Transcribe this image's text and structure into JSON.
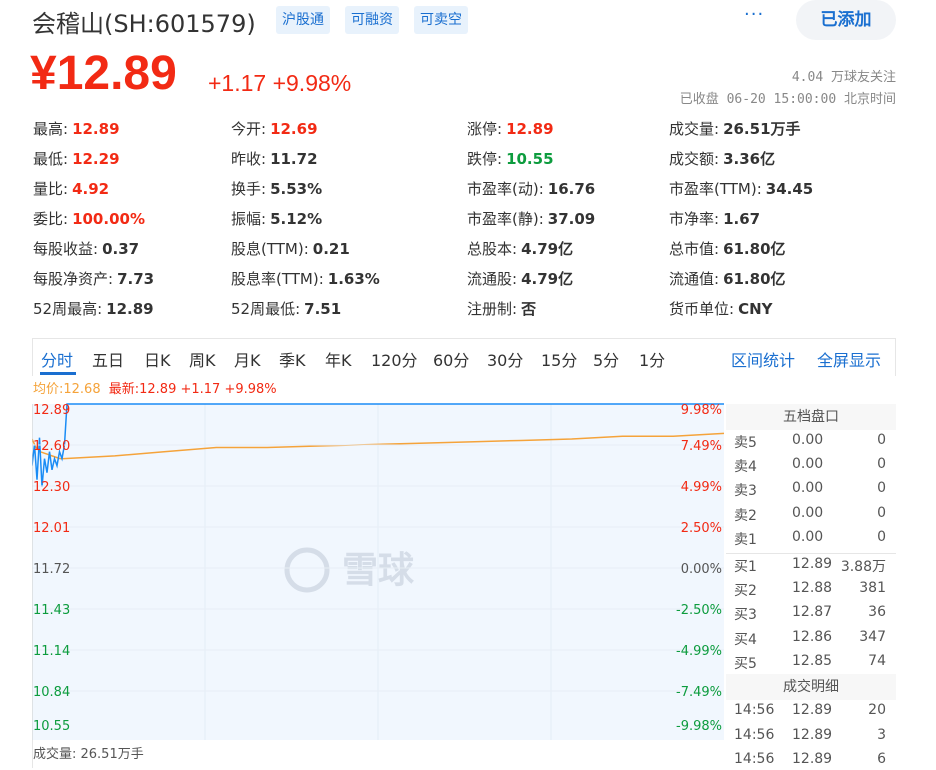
{
  "header": {
    "title": "会稽山(SH:601579)",
    "tags": [
      "沪股通",
      "可融资",
      "可卖空"
    ],
    "more": "···",
    "added_label": "已添加"
  },
  "quote": {
    "price": "¥12.89",
    "change": "+1.17 +9.98%",
    "followers": "4.04 万球友关注",
    "status": "已收盘 06-20 15:00:00 北京时间"
  },
  "stats": [
    [
      {
        "k": "最高:",
        "v": "12.89",
        "c": "red"
      },
      {
        "k": "今开:",
        "v": "12.69",
        "c": "red"
      },
      {
        "k": "涨停:",
        "v": "12.89",
        "c": "red"
      },
      {
        "k": "成交量:",
        "v": "26.51万手",
        "c": ""
      }
    ],
    [
      {
        "k": "最低:",
        "v": "12.29",
        "c": "red"
      },
      {
        "k": "昨收:",
        "v": "11.72",
        "c": ""
      },
      {
        "k": "跌停:",
        "v": "10.55",
        "c": "green"
      },
      {
        "k": "成交额:",
        "v": "3.36亿",
        "c": ""
      }
    ],
    [
      {
        "k": "量比:",
        "v": "4.92",
        "c": "red"
      },
      {
        "k": "换手:",
        "v": "5.53%",
        "c": ""
      },
      {
        "k": "市盈率(动):",
        "v": "16.76",
        "c": ""
      },
      {
        "k": "市盈率(TTM):",
        "v": "34.45",
        "c": ""
      }
    ],
    [
      {
        "k": "委比:",
        "v": "100.00%",
        "c": "red"
      },
      {
        "k": "振幅:",
        "v": "5.12%",
        "c": ""
      },
      {
        "k": "市盈率(静):",
        "v": "37.09",
        "c": ""
      },
      {
        "k": "市净率:",
        "v": "1.67",
        "c": ""
      }
    ],
    [
      {
        "k": "每股收益:",
        "v": "0.37",
        "c": ""
      },
      {
        "k": "股息(TTM):",
        "v": "0.21",
        "c": ""
      },
      {
        "k": "总股本:",
        "v": "4.79亿",
        "c": ""
      },
      {
        "k": "总市值:",
        "v": "61.80亿",
        "c": ""
      }
    ],
    [
      {
        "k": "每股净资产:",
        "v": "7.73",
        "c": ""
      },
      {
        "k": "股息率(TTM):",
        "v": "1.63%",
        "c": ""
      },
      {
        "k": "流通股:",
        "v": "4.79亿",
        "c": ""
      },
      {
        "k": "流通值:",
        "v": "61.80亿",
        "c": ""
      }
    ],
    [
      {
        "k": "52周最高:",
        "v": "12.89",
        "c": ""
      },
      {
        "k": "52周最低:",
        "v": "7.51",
        "c": ""
      },
      {
        "k": "注册制:",
        "v": "否",
        "c": ""
      },
      {
        "k": "货币单位:",
        "v": "CNY",
        "c": ""
      }
    ]
  ],
  "tabs": [
    "分时",
    "五日",
    "日K",
    "周K",
    "月K",
    "季K",
    "年K",
    "120分",
    "60分",
    "30分",
    "15分",
    "5分",
    "1分"
  ],
  "tab_actions": [
    "区间统计",
    "全屏显示"
  ],
  "chart_legend": {
    "avg": "均价:12.68",
    "latest": "最新:12.89 +1.17 +9.98%"
  },
  "chart_data": {
    "type": "line",
    "prev_close": 11.72,
    "ylim": [
      10.55,
      12.89
    ],
    "price_ticks": [
      "12.89",
      "12.60",
      "12.30",
      "12.01",
      "11.72",
      "11.43",
      "11.14",
      "10.84",
      "10.55"
    ],
    "pct_ticks": [
      "9.98%",
      "7.49%",
      "4.99%",
      "2.50%",
      "0.00%",
      "-2.50%",
      "-4.99%",
      "-7.49%",
      "-9.98%"
    ],
    "series": [
      {
        "name": "最新",
        "values": [
          12.45,
          12.6,
          12.35,
          12.65,
          12.3,
          12.5,
          12.4,
          12.55,
          12.42,
          12.5,
          12.45,
          12.55,
          12.5,
          12.6,
          12.89,
          12.89,
          12.89
        ]
      },
      {
        "name": "均价",
        "values": [
          12.64,
          12.58,
          12.55,
          12.54,
          12.53,
          12.52,
          12.51,
          12.5,
          12.5,
          12.52,
          12.55,
          12.58,
          12.58,
          12.59,
          12.6,
          12.61,
          12.62,
          12.63,
          12.64,
          12.66,
          12.66,
          12.68
        ]
      }
    ],
    "watermark": "雪球",
    "volume_label": "成交量: 26.51万手"
  },
  "orderbook": {
    "title": "五档盘口",
    "asks": [
      [
        "卖5",
        "0.00",
        "0"
      ],
      [
        "卖4",
        "0.00",
        "0"
      ],
      [
        "卖3",
        "0.00",
        "0"
      ],
      [
        "卖2",
        "0.00",
        "0"
      ],
      [
        "卖1",
        "0.00",
        "0"
      ]
    ],
    "bids": [
      [
        "买1",
        "12.89",
        "3.88万"
      ],
      [
        "买2",
        "12.88",
        "381"
      ],
      [
        "买3",
        "12.87",
        "36"
      ],
      [
        "买4",
        "12.86",
        "347"
      ],
      [
        "买5",
        "12.85",
        "74"
      ]
    ],
    "trades_title": "成交明细",
    "trades": [
      [
        "14:56",
        "12.89",
        "20"
      ],
      [
        "14:56",
        "12.89",
        "3"
      ],
      [
        "14:56",
        "12.89",
        "6"
      ]
    ]
  },
  "colors": {
    "up": "#f22a14",
    "down": "#0d9c3e",
    "accent": "#1a6fd0",
    "avg": "#f5a33a"
  }
}
